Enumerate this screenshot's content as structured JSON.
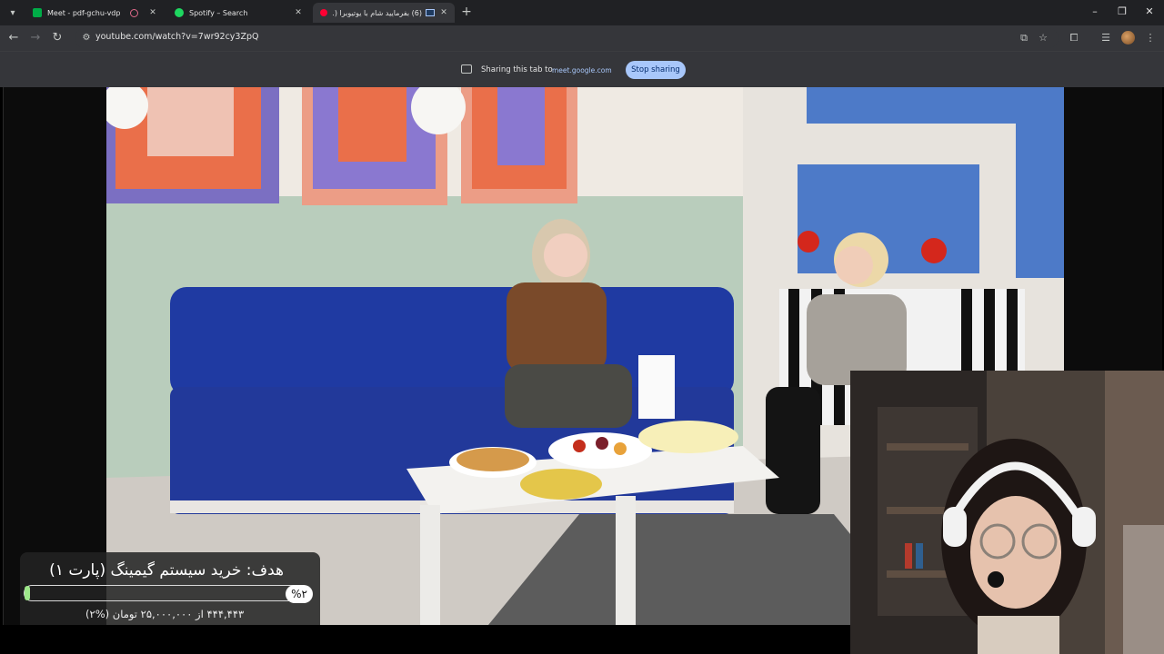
{
  "browser": {
    "tabs": [
      {
        "title": "Meet - pdf-gchu-vdp",
        "icon": "google-meet-icon",
        "icon_color": "#00ac47",
        "recording": true,
        "active": false
      },
      {
        "title": "Spotify – Search",
        "icon": "spotify-icon",
        "icon_color": "#1ed760",
        "recording": false,
        "active": false
      },
      {
        "title": "(6) بفرمایید شام با یوتیوبرا (...",
        "icon": "youtube-icon",
        "icon_color": "#ff0033",
        "recording": false,
        "active": true
      }
    ],
    "new_tab": "+",
    "window_controls": {
      "minimize": "–",
      "maximize": "❐",
      "close": "✕"
    },
    "url": "youtube.com/watch?v=7wr92cy3ZpQ"
  },
  "share_bar": {
    "text": "Sharing this tab to",
    "target": "meet.google.com",
    "stop_label": "Stop sharing"
  },
  "overlay": {
    "goal_title": "هدف: خرید سیستم گیمینگ (پارت ۱)",
    "progress_percent": 2,
    "progress_label": "%۲",
    "progress_text": "۴۴۴,۴۴۳ از ۲۵,۰۰۰,۰۰۰ تومان (%۲)",
    "progress_color": "#9ee88a"
  },
  "colors": {
    "chrome_dark": "#202124",
    "toolbar": "#35363a",
    "stop_button": "#a8c7fa"
  }
}
